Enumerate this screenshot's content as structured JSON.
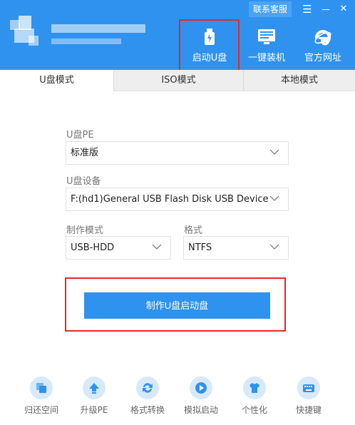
{
  "header": {
    "contact_label": "联系客服",
    "menu_glyph": "☰",
    "minimize_glyph": "—",
    "close_glyph": "✕",
    "nav": [
      {
        "label": "启动U盘",
        "icon": "usb-drive-icon"
      },
      {
        "label": "一键装机",
        "icon": "monitor-icon"
      },
      {
        "label": "官方网址",
        "icon": "ie-browser-icon"
      }
    ]
  },
  "tabs": [
    {
      "label": "U盘模式",
      "active": true
    },
    {
      "label": "ISO模式",
      "active": false
    },
    {
      "label": "本地模式",
      "active": false
    }
  ],
  "form": {
    "pe_label": "U盘PE",
    "pe_value": "标准版",
    "device_label": "U盘设备",
    "device_value": "F:(hd1)General USB Flash Disk USB Device",
    "mode_label": "制作模式",
    "mode_value": "USB-HDD",
    "format_label": "格式",
    "format_value": "NTFS"
  },
  "make_button": "制作U盘启动盘",
  "tools": [
    {
      "label": "归还空间",
      "icon": "restore-space-icon"
    },
    {
      "label": "升级PE",
      "icon": "upgrade-icon"
    },
    {
      "label": "格式转换",
      "icon": "convert-icon"
    },
    {
      "label": "模拟启动",
      "icon": "play-icon"
    },
    {
      "label": "个性化",
      "icon": "tshirt-icon"
    },
    {
      "label": "快捷键",
      "icon": "keyboard-icon"
    }
  ],
  "colors": {
    "accent": "#2f92ee",
    "highlight_border": "#e6272e",
    "tool_circle": "#d7e9fb"
  }
}
